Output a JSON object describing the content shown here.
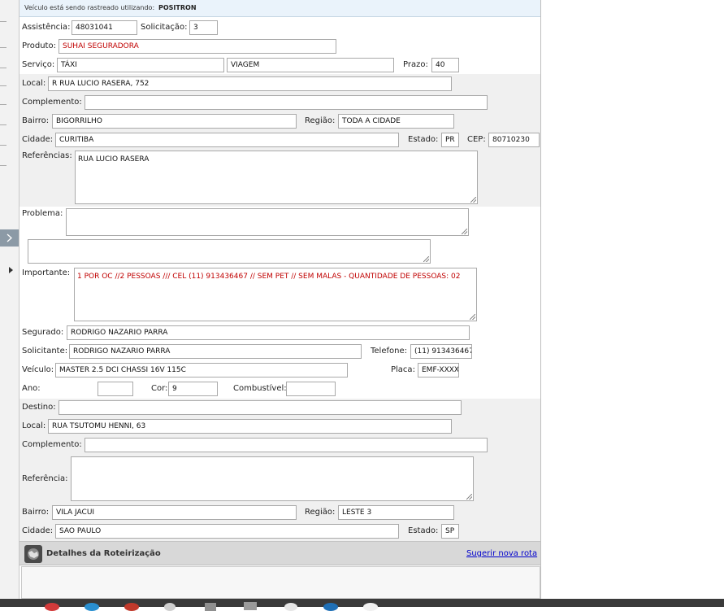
{
  "tracking": {
    "prefix": "Veículo está sendo rastreado utilizando:",
    "provider": "POSITRON"
  },
  "labels": {
    "assistencia": "Assistência:",
    "solicitacao": "Solicitação:",
    "produto": "Produto:",
    "servico": "Serviço:",
    "prazo": "Prazo:",
    "local": "Local:",
    "complemento": "Complemento:",
    "bairro": "Bairro:",
    "regiao": "Região:",
    "cidade": "Cidade:",
    "estado": "Estado:",
    "cep": "CEP:",
    "referencias": "Referências:",
    "problema": "Problema:",
    "importante": "Importante:",
    "segurado": "Segurado:",
    "solicitante": "Solicitante:",
    "telefone": "Telefone:",
    "veiculo": "Veículo:",
    "placa": "Placa:",
    "ano": "Ano:",
    "cor": "Cor:",
    "combustivel": "Combustível:",
    "destino": "Destino:",
    "referencia": "Referência:"
  },
  "fields": {
    "assistencia": "48031041",
    "solicitacao": "3",
    "produto": "SUHAI SEGURADORA",
    "servico": "TÁXI",
    "servico2": "VIAGEM",
    "prazo": "40",
    "local": "R RUA LUCIO RASERA, 752",
    "complemento": "",
    "bairro": "BIGORRILHO",
    "regiao": "TODA A CIDADE",
    "cidade": "CURITIBA",
    "estado": "PR",
    "cep": "80710230",
    "referencias": "RUA LUCIO RASERA",
    "problema": "",
    "problema2": "",
    "importante": "1 POR OC //2 PESSOAS /// CEL (11) 913436467 // SEM PET // SEM MALAS - QUANTIDADE DE PESSOAS: 02",
    "segurado": "RODRIGO NAZARIO PARRA",
    "solicitante": "RODRIGO NAZARIO PARRA",
    "telefone": "(11) 913436467",
    "veiculo": "MASTER 2.5 DCI CHASSI 16V 115C",
    "placa": "EMF-XXXX",
    "ano": "",
    "cor": "9",
    "combustivel": ""
  },
  "destino": {
    "destino": "",
    "local": "RUA TSUTOMU HENNI, 63",
    "complemento": "",
    "referencia": "",
    "bairro": "VILA JACUI",
    "regiao": "LESTE 3",
    "cidade": "SAO PAULO",
    "estado": "SP"
  },
  "route": {
    "title": "Detalhes da Roteirização",
    "link": "Sugerir nova rota"
  },
  "colors": {
    "tracking_bg": "#eaf3fb",
    "band_bg": "#f0f0f0",
    "route_bar": "#d8d8d8",
    "link": "#0000cc",
    "important_text": "#c00000",
    "taskbar": "#3a3a3a"
  }
}
